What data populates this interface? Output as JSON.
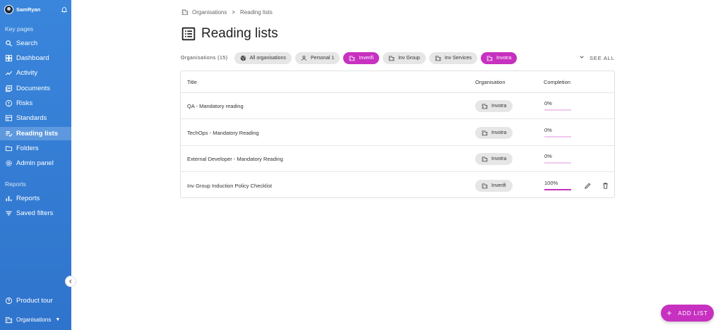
{
  "sidebar": {
    "user_name": "SamRyan",
    "section_key_pages": "Key pages",
    "items": [
      {
        "label": "Search",
        "icon": "search-icon"
      },
      {
        "label": "Dashboard",
        "icon": "dashboard-icon"
      },
      {
        "label": "Activity",
        "icon": "activity-icon"
      },
      {
        "label": "Documents",
        "icon": "documents-icon"
      },
      {
        "label": "Risks",
        "icon": "risk-icon"
      },
      {
        "label": "Standards",
        "icon": "standards-icon"
      },
      {
        "label": "Reading lists",
        "icon": "reading-list-icon",
        "active": true
      },
      {
        "label": "Folders",
        "icon": "folder-icon"
      },
      {
        "label": "Admin panel",
        "icon": "gear-icon"
      }
    ],
    "section_reports": "Reports",
    "report_items": [
      {
        "label": "Reports",
        "icon": "bar-chart-icon"
      },
      {
        "label": "Saved filters",
        "icon": "filter-icon"
      }
    ],
    "product_tour": "Product tour",
    "organisations": "Organisations"
  },
  "breadcrumb": {
    "root": "Organisations",
    "current": "Reading lists"
  },
  "page": {
    "title": "Reading lists"
  },
  "filters": {
    "label": "Organisations (15)",
    "chips": [
      {
        "label": "All organisations",
        "icon": "globe-icon",
        "active": false
      },
      {
        "label": "Personal 1",
        "icon": "person-icon",
        "active": false
      },
      {
        "label": "Inverifi",
        "icon": "building-icon",
        "active": true
      },
      {
        "label": "Inv Group",
        "icon": "building-icon",
        "active": false
      },
      {
        "label": "Inv Services",
        "icon": "building-icon",
        "active": false
      },
      {
        "label": "Invotra",
        "icon": "building-icon",
        "active": true
      }
    ],
    "see_all": "SEE ALL"
  },
  "table": {
    "columns": [
      "Title",
      "Organisation",
      "Completion"
    ],
    "rows": [
      {
        "title": "QA - Mandatory reading",
        "organisation": "Invotra",
        "completion": "0%",
        "completion_value": 0,
        "actions": false
      },
      {
        "title": "TechOps - Mandatory Reading",
        "organisation": "Invotra",
        "completion": "0%",
        "completion_value": 0,
        "actions": false
      },
      {
        "title": "External Developer - Mandatory Reading",
        "organisation": "Invotra",
        "completion": "0%",
        "completion_value": 0,
        "actions": false
      },
      {
        "title": "Inv Group Induction Policy Checklist",
        "organisation": "Inverifi",
        "completion": "100%",
        "completion_value": 100,
        "actions": true
      }
    ]
  },
  "fab": {
    "label": "ADD LIST"
  },
  "colors": {
    "sidebar": "#3a86dc",
    "accent": "#c730c0",
    "chip": "#e6e6e6"
  }
}
